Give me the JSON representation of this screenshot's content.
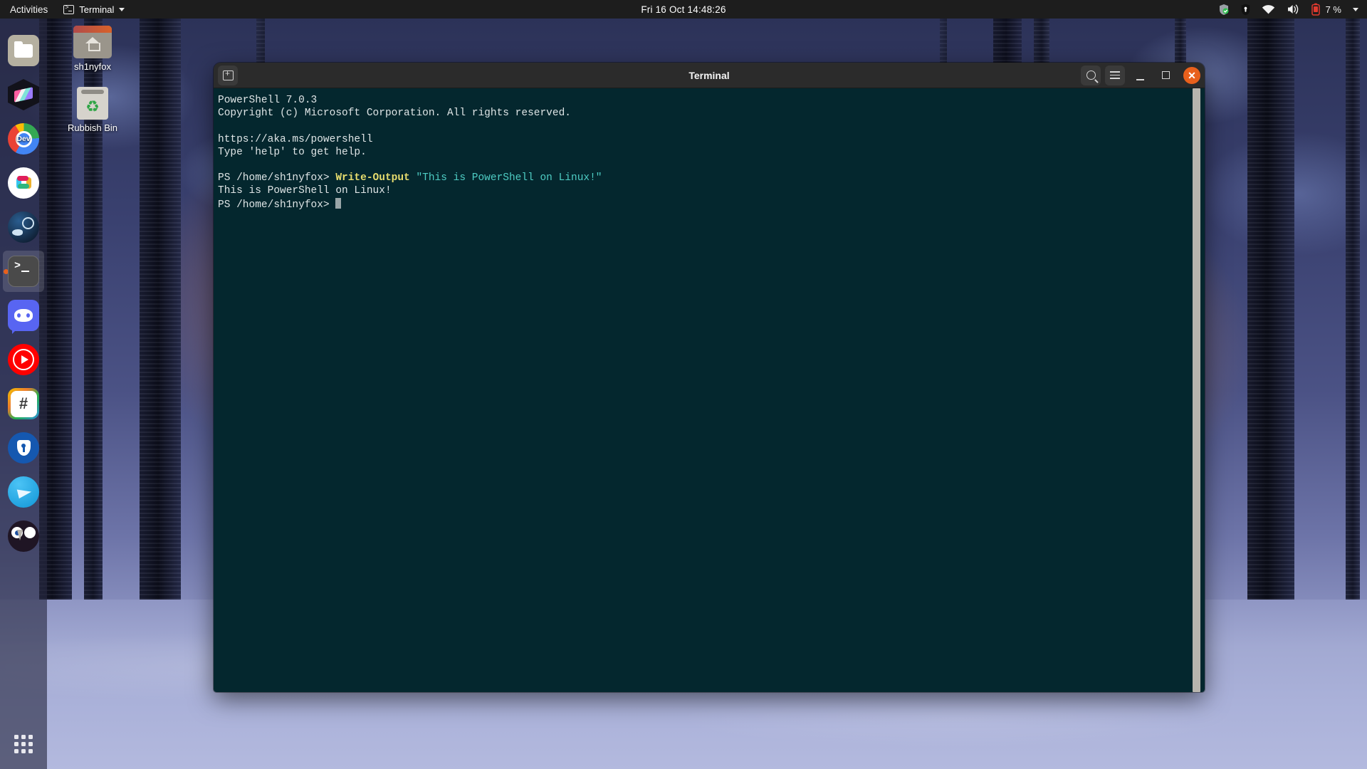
{
  "topbar": {
    "activities": "Activities",
    "app_name": "Terminal",
    "app_icon": "terminal-icon",
    "caret_icon": "chevron-down-icon",
    "clock": "Fri 16 Oct  14:48:26",
    "status_icons": [
      "shield-check-icon",
      "bitwarden-vault-icon",
      "wifi-icon",
      "volume-icon",
      "battery-low-icon"
    ],
    "battery_percent": "7 %",
    "system_menu_caret": "chevron-down-icon",
    "bg_color": "#1d1d1d"
  },
  "dock": {
    "items": [
      {
        "name": "files",
        "label": "Files",
        "icon": "files-folder-icon",
        "active": false,
        "running": false
      },
      {
        "name": "warp",
        "label": "Warp",
        "icon": "hexagon-sheets-icon",
        "active": false,
        "running": false
      },
      {
        "name": "chrome-dev",
        "label": "Chrome Dev",
        "icon": "chrome-icon",
        "badge": "Dev",
        "active": false,
        "running": false
      },
      {
        "name": "slack",
        "label": "Slack",
        "icon": "slack-icon",
        "active": false,
        "running": false
      },
      {
        "name": "steam",
        "label": "Steam",
        "icon": "steam-icon",
        "active": false,
        "running": false
      },
      {
        "name": "terminal",
        "label": "Terminal",
        "icon": "terminal-icon",
        "active": true,
        "running": true
      },
      {
        "name": "discord",
        "label": "Discord",
        "icon": "discord-icon",
        "active": false,
        "running": false
      },
      {
        "name": "youtube-music",
        "label": "YouTube Music",
        "icon": "youtube-music-icon",
        "active": false,
        "running": false
      },
      {
        "name": "software",
        "label": "Software",
        "icon": "hash-icon",
        "badge_text": "#",
        "active": false,
        "running": false
      },
      {
        "name": "bitwarden",
        "label": "Bitwarden",
        "icon": "bitwarden-icon",
        "active": false,
        "running": false
      },
      {
        "name": "telegram",
        "label": "Telegram",
        "icon": "telegram-icon",
        "active": false,
        "running": false
      },
      {
        "name": "kiwi-owl",
        "label": "Owl",
        "icon": "owl-icon",
        "active": false,
        "running": false
      }
    ],
    "show_apps_label": "Show Applications",
    "show_apps_icon": "app-grid-icon"
  },
  "desktop": {
    "icons": [
      {
        "name": "home-folder",
        "label": "sh1nyfox",
        "icon": "home-folder-icon"
      },
      {
        "name": "trash",
        "label": "Rubbish Bin",
        "icon": "recycle-bin-icon"
      }
    ]
  },
  "terminal": {
    "title": "Terminal",
    "newtab_icon": "new-tab-icon",
    "search_icon": "search-icon",
    "menu_icon": "hamburger-menu-icon",
    "minimize_icon": "minimize-icon",
    "maximize_icon": "maximize-icon",
    "close_icon": "close-icon",
    "bg_color": "#04272e",
    "close_color": "#e8601c",
    "lines": [
      [
        {
          "t": "PowerShell 7.0.3",
          "c": "white"
        }
      ],
      [
        {
          "t": "Copyright (c) Microsoft Corporation. All rights reserved.",
          "c": "white"
        }
      ],
      [
        {
          "t": "",
          "c": "white"
        }
      ],
      [
        {
          "t": "https://aka.ms/powershell",
          "c": "white"
        }
      ],
      [
        {
          "t": "Type 'help' to get help.",
          "c": "white"
        }
      ],
      [
        {
          "t": "",
          "c": "white"
        }
      ],
      [
        {
          "t": "PS /home/sh1nyfox> ",
          "c": "white"
        },
        {
          "t": "Write-Output",
          "c": "yellow"
        },
        {
          "t": " ",
          "c": "white"
        },
        {
          "t": "\"This is PowerShell on Linux!\"",
          "c": "cyan"
        }
      ],
      [
        {
          "t": "This is PowerShell on Linux!",
          "c": "white"
        }
      ],
      [
        {
          "t": "PS /home/sh1nyfox> ",
          "c": "white"
        },
        {
          "t": "",
          "c": "cursor"
        }
      ]
    ],
    "scrollbar": "vertical-scrollbar"
  }
}
